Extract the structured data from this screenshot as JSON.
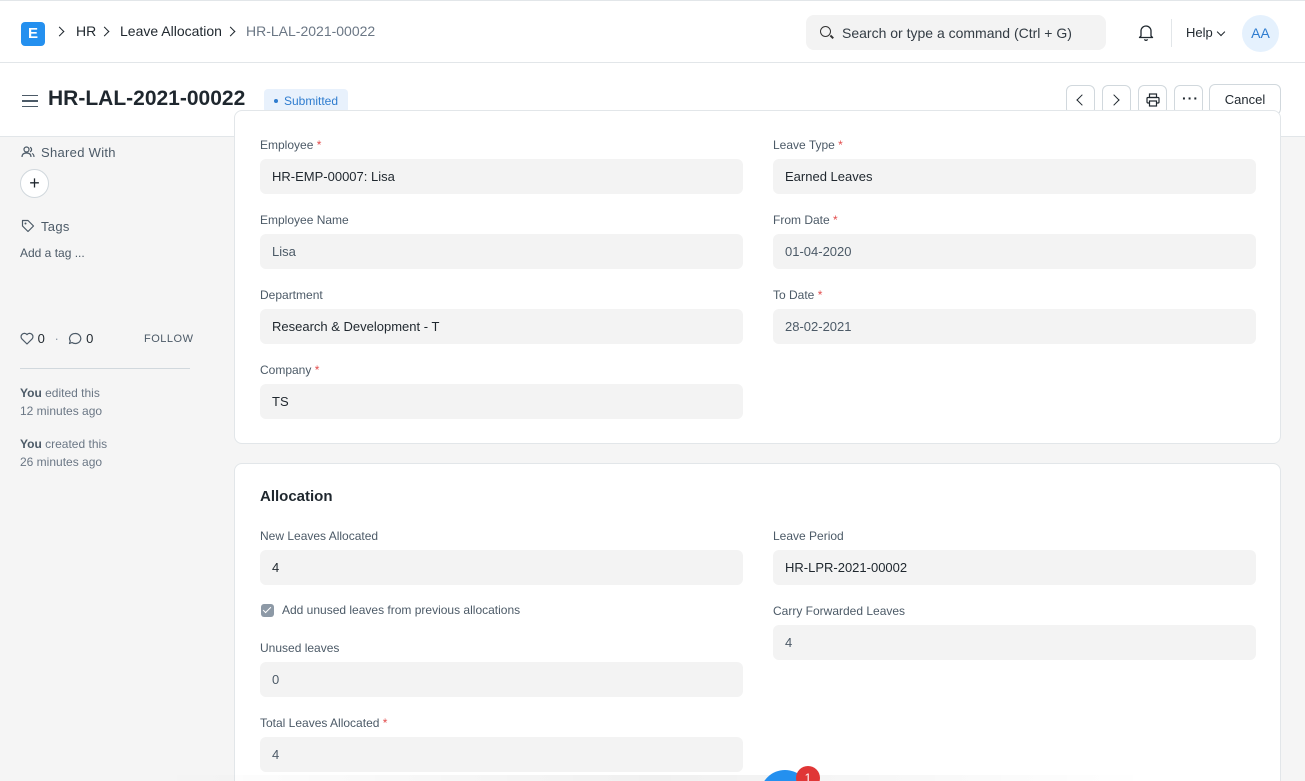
{
  "navbar": {
    "logo_letter": "E",
    "breadcrumbs": [
      "HR",
      "Leave Allocation",
      "HR-LAL-2021-00022"
    ],
    "search_placeholder": "Search or type a command (Ctrl + G)",
    "help_label": "Help",
    "avatar_initials": "AA"
  },
  "header": {
    "title": "HR-LAL-2021-00022",
    "status": "Submitted",
    "cancel_label": "Cancel"
  },
  "sidebar": {
    "shared_with_label": "Shared With",
    "tags_label": "Tags",
    "add_tag_label": "Add a tag ...",
    "likes": "0",
    "comments": "0",
    "follow_label": "FOLLOW",
    "activity": [
      {
        "user": "You",
        "action": "edited this",
        "time": "12 minutes ago"
      },
      {
        "user": "You",
        "action": "created this",
        "time": "26 minutes ago"
      }
    ]
  },
  "details": {
    "employee_label": "Employee",
    "employee_value": "HR-EMP-00007: Lisa",
    "employee_name_label": "Employee Name",
    "employee_name_value": "Lisa",
    "department_label": "Department",
    "department_value": "Research & Development - T",
    "company_label": "Company",
    "company_value": "TS",
    "leave_type_label": "Leave Type",
    "leave_type_value": "Earned Leaves",
    "from_date_label": "From Date",
    "from_date_value": "01-04-2020",
    "to_date_label": "To Date",
    "to_date_value": "28-02-2021"
  },
  "allocation": {
    "section_title": "Allocation",
    "new_leaves_label": "New Leaves Allocated",
    "new_leaves_value": "4",
    "carry_forward_label": "Add unused leaves from previous allocations",
    "carry_forward_checked": true,
    "unused_label": "Unused leaves",
    "unused_value": "0",
    "total_label": "Total Leaves Allocated",
    "total_value": "4",
    "leave_period_label": "Leave Period",
    "leave_period_value": "HR-LPR-2021-00002",
    "carry_forwarded_label": "Carry Forwarded Leaves",
    "carry_forwarded_value": "4"
  },
  "notification_count": "1",
  "colors": {
    "primary": "#2490ef",
    "required": "#e24c4c",
    "status": "#2e7ccf"
  }
}
